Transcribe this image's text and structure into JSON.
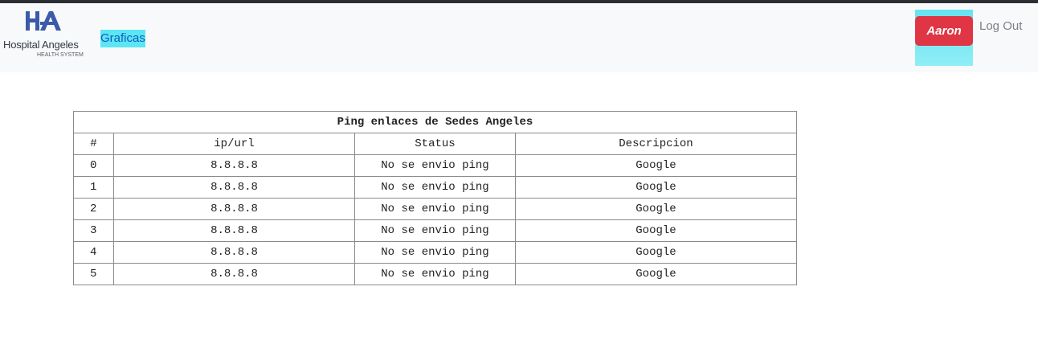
{
  "brand": {
    "name": "Hospital Angeles",
    "subtitle": "HEALTH SYSTEM",
    "icon": "hospital-angeles-logo",
    "color": "#3b5aa8"
  },
  "nav": {
    "graficas_label": "Graficas"
  },
  "user": {
    "name": "Aaron",
    "logout_label": "Log Out"
  },
  "table": {
    "caption": "Ping enlaces de Sedes Angeles",
    "headers": [
      "#",
      "ip/url",
      "Status",
      "Descripcion"
    ],
    "rows": [
      [
        "0",
        "8.8.8.8",
        "No se envio ping",
        "Google"
      ],
      [
        "1",
        "8.8.8.8",
        "No se envio ping",
        "Google"
      ],
      [
        "2",
        "8.8.8.8",
        "No se envio ping",
        "Google"
      ],
      [
        "3",
        "8.8.8.8",
        "No se envio ping",
        "Google"
      ],
      [
        "4",
        "8.8.8.8",
        "No se envio ping",
        "Google"
      ],
      [
        "5",
        "8.8.8.8",
        "No se envio ping",
        "Google"
      ]
    ]
  },
  "colors": {
    "user_button": "#e03545",
    "highlight": "#5ce6f3",
    "navbar": "#f8f9fa"
  }
}
